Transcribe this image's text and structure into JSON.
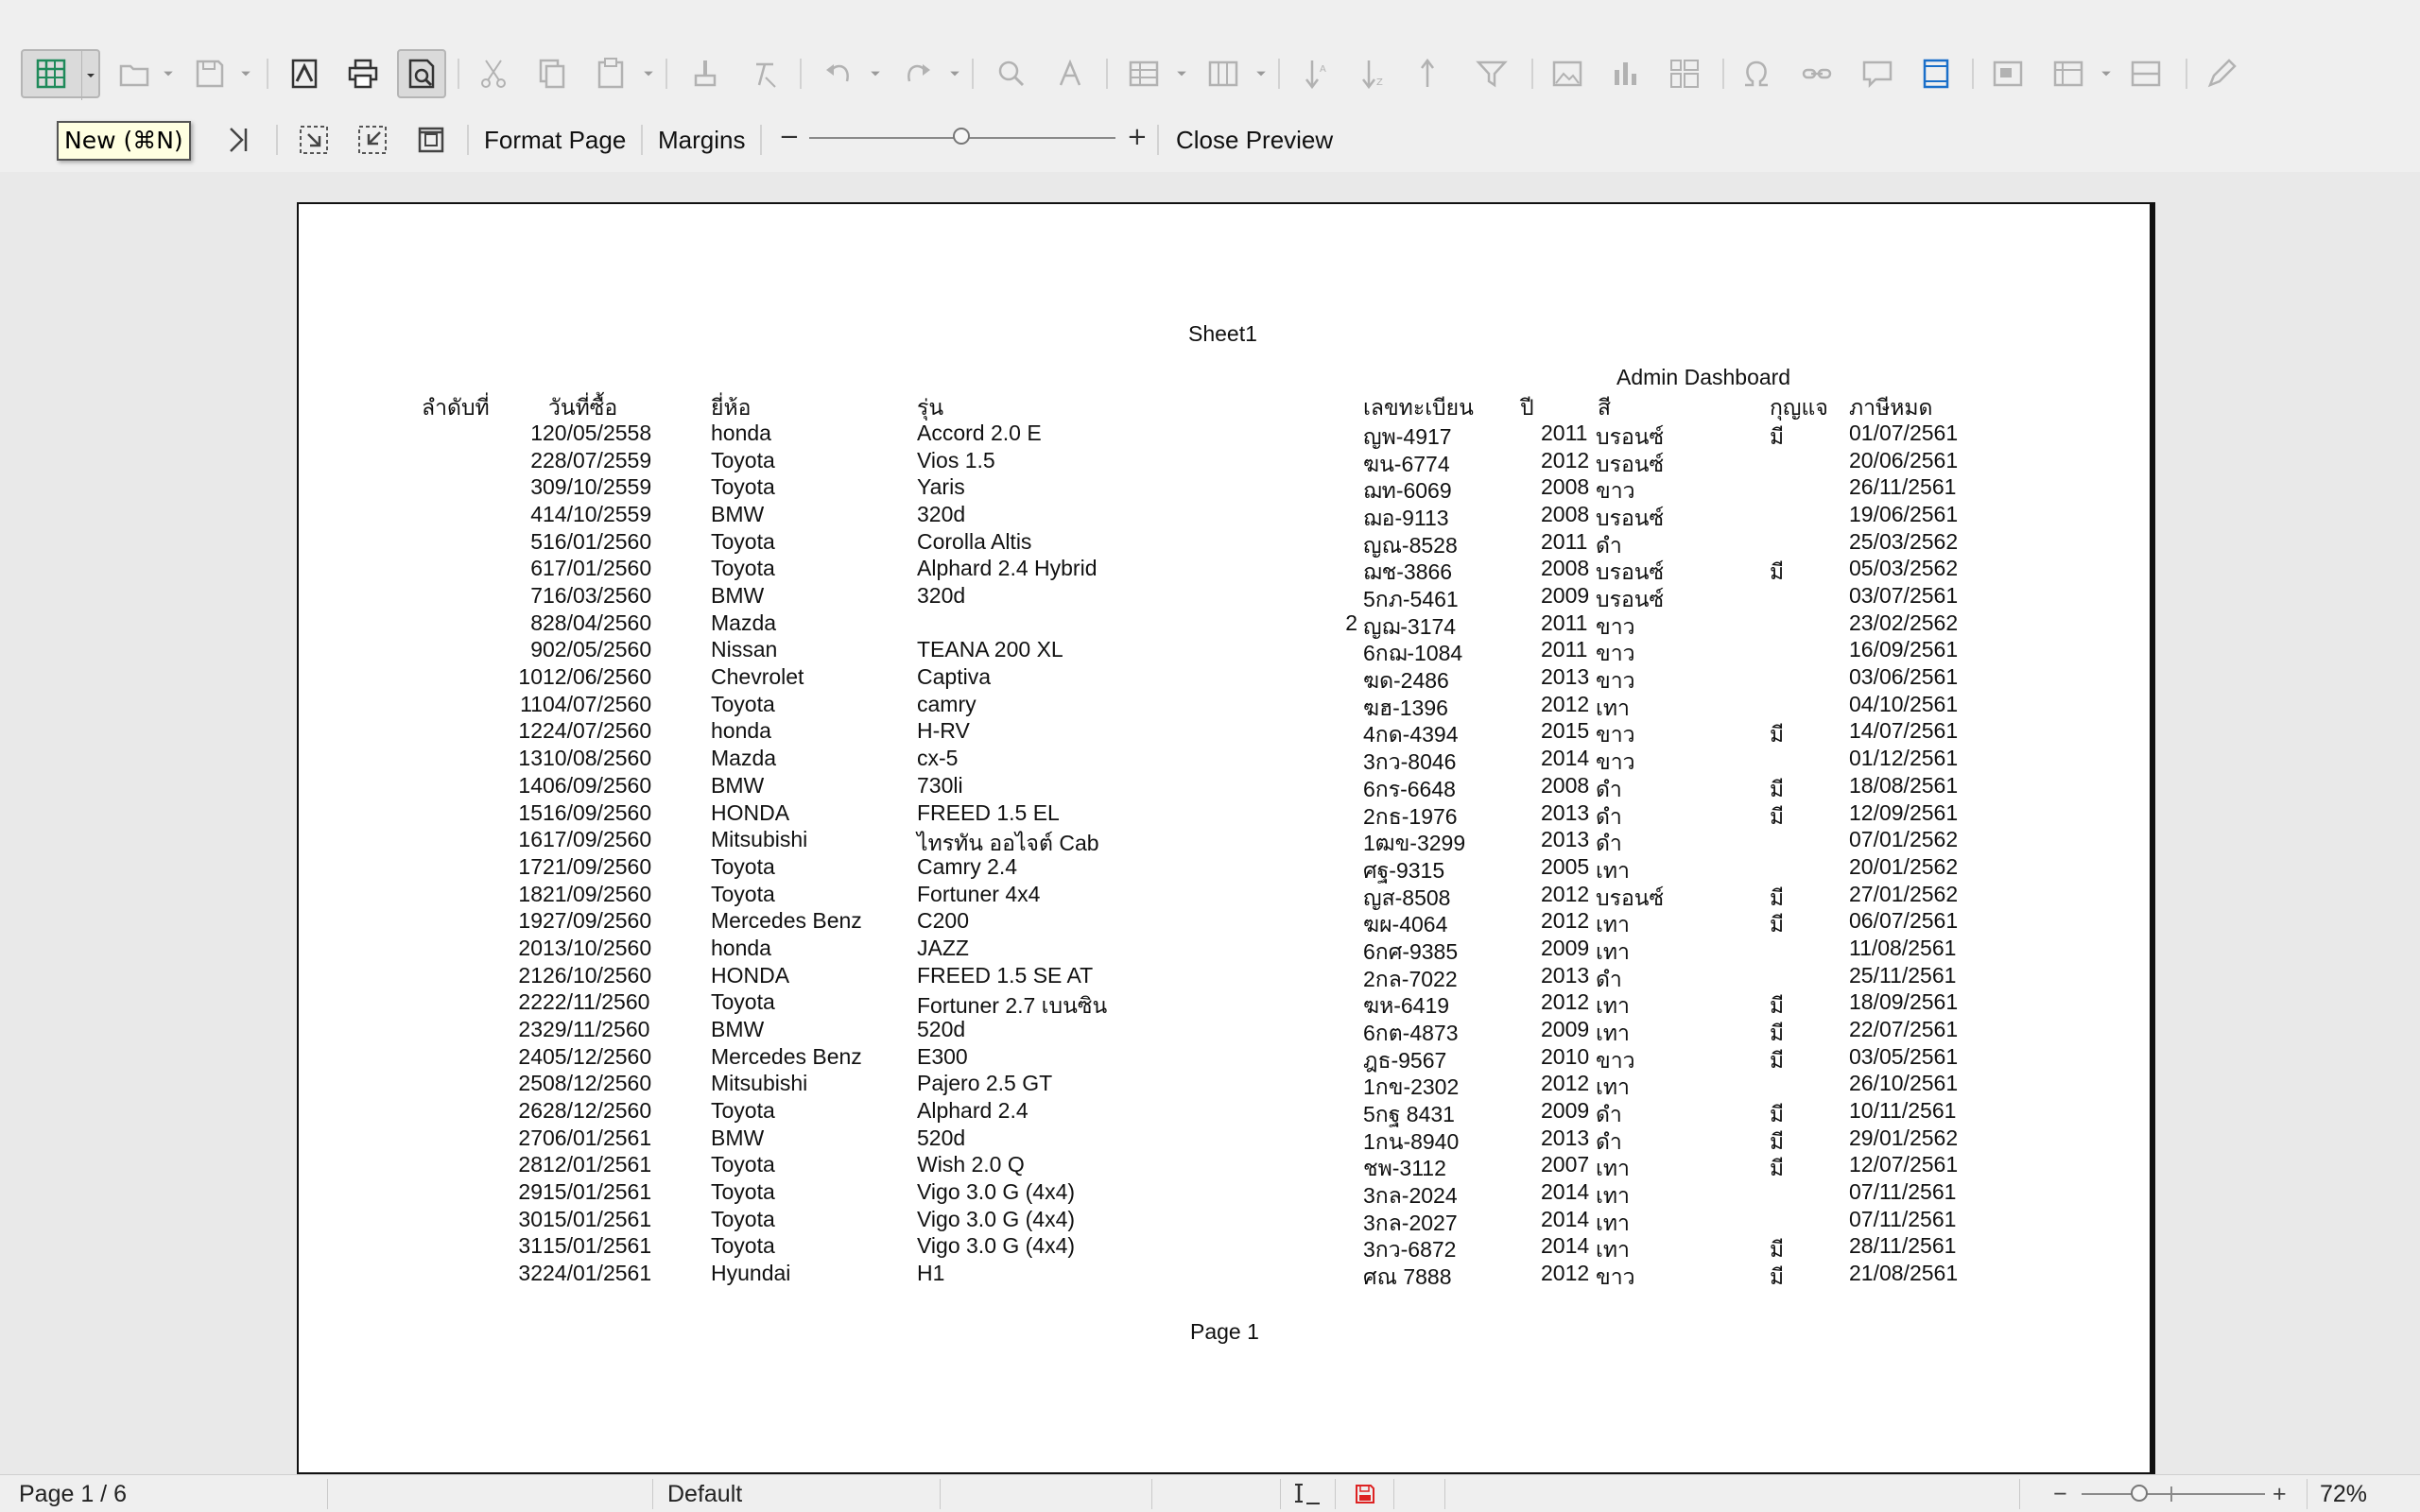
{
  "toolbar": {
    "tooltip": "New (⌘N)",
    "buttons": [
      "new-spreadsheet",
      "open",
      "save",
      "export-pdf",
      "print",
      "print-preview",
      "cut",
      "copy",
      "paste",
      "clone-formatting",
      "clear-formatting",
      "undo",
      "redo",
      "find-replace",
      "spelling",
      "rows",
      "columns",
      "sort-ascending",
      "sort-descending",
      "autofilter",
      "insert-image",
      "insert-chart",
      "pivot-table",
      "special-character",
      "hyperlink",
      "comment",
      "headers-footers",
      "define-print-area",
      "freeze-rows-columns",
      "split-window",
      "show-draw-functions"
    ]
  },
  "preview_bar": {
    "format_page": "Format Page",
    "margins": "Margins",
    "zoom_minus": "−",
    "zoom_plus": "+",
    "close_preview": "Close Preview"
  },
  "document": {
    "sheet_title": "Sheet1",
    "dashboard_title": "Admin Dashboard",
    "page_footer": "Page 1",
    "headers": [
      "ลำดับที่",
      "วันที่ซื้อ",
      "ยี่ห้อ",
      "รุ่น",
      "เลขทะเบียน",
      "ปี",
      "สี",
      "กุญแจ",
      "ภาษีหมด"
    ],
    "rows": [
      [
        "1",
        "20/05/2558",
        "honda",
        "Accord 2.0 E",
        "",
        "ญพ-4917",
        "2011",
        "บรอนซ์",
        "มี",
        "01/07/2561"
      ],
      [
        "2",
        "28/07/2559",
        "Toyota",
        "Vios 1.5",
        "",
        "ฆน-6774",
        "2012",
        "บรอนซ์",
        "",
        "20/06/2561"
      ],
      [
        "3",
        "09/10/2559",
        "Toyota",
        "Yaris",
        "",
        "ฌท-6069",
        "2008",
        "ขาว",
        "",
        "26/11/2561"
      ],
      [
        "4",
        "14/10/2559",
        "BMW",
        "320d",
        "",
        "ฌอ-9113",
        "2008",
        "บรอนซ์",
        "",
        "19/06/2561"
      ],
      [
        "5",
        "16/01/2560",
        "Toyota",
        "Corolla Altis",
        "",
        "ญณ-8528",
        "2011",
        "ดำ",
        "",
        "25/03/2562"
      ],
      [
        "6",
        "17/01/2560",
        "Toyota",
        "Alphard 2.4 Hybrid",
        "",
        "ฌช-3866",
        "2008",
        "บรอนซ์",
        "มี",
        "05/03/2562"
      ],
      [
        "7",
        "16/03/2560",
        "BMW",
        "320d",
        "",
        "5กภ-5461",
        "2009",
        "บรอนซ์",
        "",
        "03/07/2561"
      ],
      [
        "8",
        "28/04/2560",
        "Mazda",
        "",
        "2",
        "ญฌ-3174",
        "2011",
        "ขาว",
        "",
        "23/02/2562"
      ],
      [
        "9",
        "02/05/2560",
        "Nissan",
        "TEANA 200 XL",
        "",
        "6กฌ-1084",
        "2011",
        "ขาว",
        "",
        "16/09/2561"
      ],
      [
        "10",
        "12/06/2560",
        "Chevrolet",
        "Captiva",
        "",
        "ฆด-2486",
        "2013",
        "ขาว",
        "",
        "03/06/2561"
      ],
      [
        "11",
        "04/07/2560",
        "Toyota",
        "camry",
        "",
        "ฆฮ-1396",
        "2012",
        "เทา",
        "",
        "04/10/2561"
      ],
      [
        "12",
        "24/07/2560",
        "honda",
        "H-RV",
        "",
        "4กด-4394",
        "2015",
        "ขาว",
        "มี",
        "14/07/2561"
      ],
      [
        "13",
        "10/08/2560",
        "Mazda",
        "cx-5",
        "",
        "3กว-8046",
        "2014",
        "ขาว",
        "",
        "01/12/2561"
      ],
      [
        "14",
        "06/09/2560",
        "BMW",
        "730li",
        "",
        "6กร-6648",
        "2008",
        "ดำ",
        "มี",
        "18/08/2561"
      ],
      [
        "15",
        "16/09/2560",
        "HONDA",
        "FREED 1.5 EL",
        "",
        "2กธ-1976",
        "2013",
        "ดำ",
        "มี",
        "12/09/2561"
      ],
      [
        "16",
        "17/09/2560",
        "Mitsubishi",
        "ไทรทัน ออไจต์ Cab",
        "",
        "1ฒข-3299",
        "2013",
        "ดำ",
        "",
        "07/01/2562"
      ],
      [
        "17",
        "21/09/2560",
        "Toyota",
        "Camry 2.4",
        "",
        "ศฐ-9315",
        "2005",
        "เทา",
        "",
        "20/01/2562"
      ],
      [
        "18",
        "21/09/2560",
        "Toyota",
        "Fortuner 4x4",
        "",
        "ญส-8508",
        "2012",
        "บรอนซ์",
        "มี",
        "27/01/2562"
      ],
      [
        "19",
        "27/09/2560",
        "Mercedes Benz",
        "C200",
        "",
        "ฆผ-4064",
        "2012",
        "เทา",
        "มี",
        "06/07/2561"
      ],
      [
        "20",
        "13/10/2560",
        "honda",
        "JAZZ",
        "",
        "6กศ-9385",
        "2009",
        "เทา",
        "",
        "11/08/2561"
      ],
      [
        "21",
        "26/10/2560",
        "HONDA",
        "FREED 1.5 SE AT",
        "",
        "2กล-7022",
        "2013",
        "ดำ",
        "",
        "25/11/2561"
      ],
      [
        "22",
        "22/11/2560",
        "Toyota",
        "Fortuner 2.7 เบนซิน",
        "",
        "ฆห-6419",
        "2012",
        "เทา",
        "มี",
        "18/09/2561"
      ],
      [
        "23",
        "29/11/2560",
        "BMW",
        "520d",
        "",
        "6กต-4873",
        "2009",
        "เทา",
        "มี",
        "22/07/2561"
      ],
      [
        "24",
        "05/12/2560",
        "Mercedes Benz",
        "E300",
        "",
        "ฎธ-9567",
        "2010",
        "ขาว",
        "มี",
        "03/05/2561"
      ],
      [
        "25",
        "08/12/2560",
        "Mitsubishi",
        "Pajero 2.5 GT",
        "",
        "1กข-2302",
        "2012",
        "เทา",
        "",
        "26/10/2561"
      ],
      [
        "26",
        "28/12/2560",
        "Toyota",
        "Alphard 2.4",
        "",
        "5กฐ 8431",
        "2009",
        "ดำ",
        "มี",
        "10/11/2561"
      ],
      [
        "27",
        "06/01/2561",
        "BMW",
        "520d",
        "",
        "1กน-8940",
        "2013",
        "ดำ",
        "มี",
        "29/01/2562"
      ],
      [
        "28",
        "12/01/2561",
        "Toyota",
        "Wish 2.0 Q",
        "",
        "ชพ-3112",
        "2007",
        "เทา",
        "มี",
        "12/07/2561"
      ],
      [
        "29",
        "15/01/2561",
        "Toyota",
        "Vigo 3.0 G (4x4)",
        "",
        "3กล-2024",
        "2014",
        "เทา",
        "",
        "07/11/2561"
      ],
      [
        "30",
        "15/01/2561",
        "Toyota",
        "Vigo 3.0 G (4x4)",
        "",
        "3กล-2027",
        "2014",
        "เทา",
        "",
        "07/11/2561"
      ],
      [
        "31",
        "15/01/2561",
        "Toyota",
        "Vigo 3.0 G (4x4)",
        "",
        "3กว-6872",
        "2014",
        "เทา",
        "มี",
        "28/11/2561"
      ],
      [
        "32",
        "24/01/2561",
        "Hyundai",
        "H1",
        "",
        "ศณ 7888",
        "2012",
        "ขาว",
        "มี",
        "21/08/2561"
      ]
    ]
  },
  "statusbar": {
    "page": "Page 1 / 6",
    "page_style": "Default",
    "zoom_minus": "−",
    "zoom_plus": "+",
    "zoom": "72%"
  }
}
